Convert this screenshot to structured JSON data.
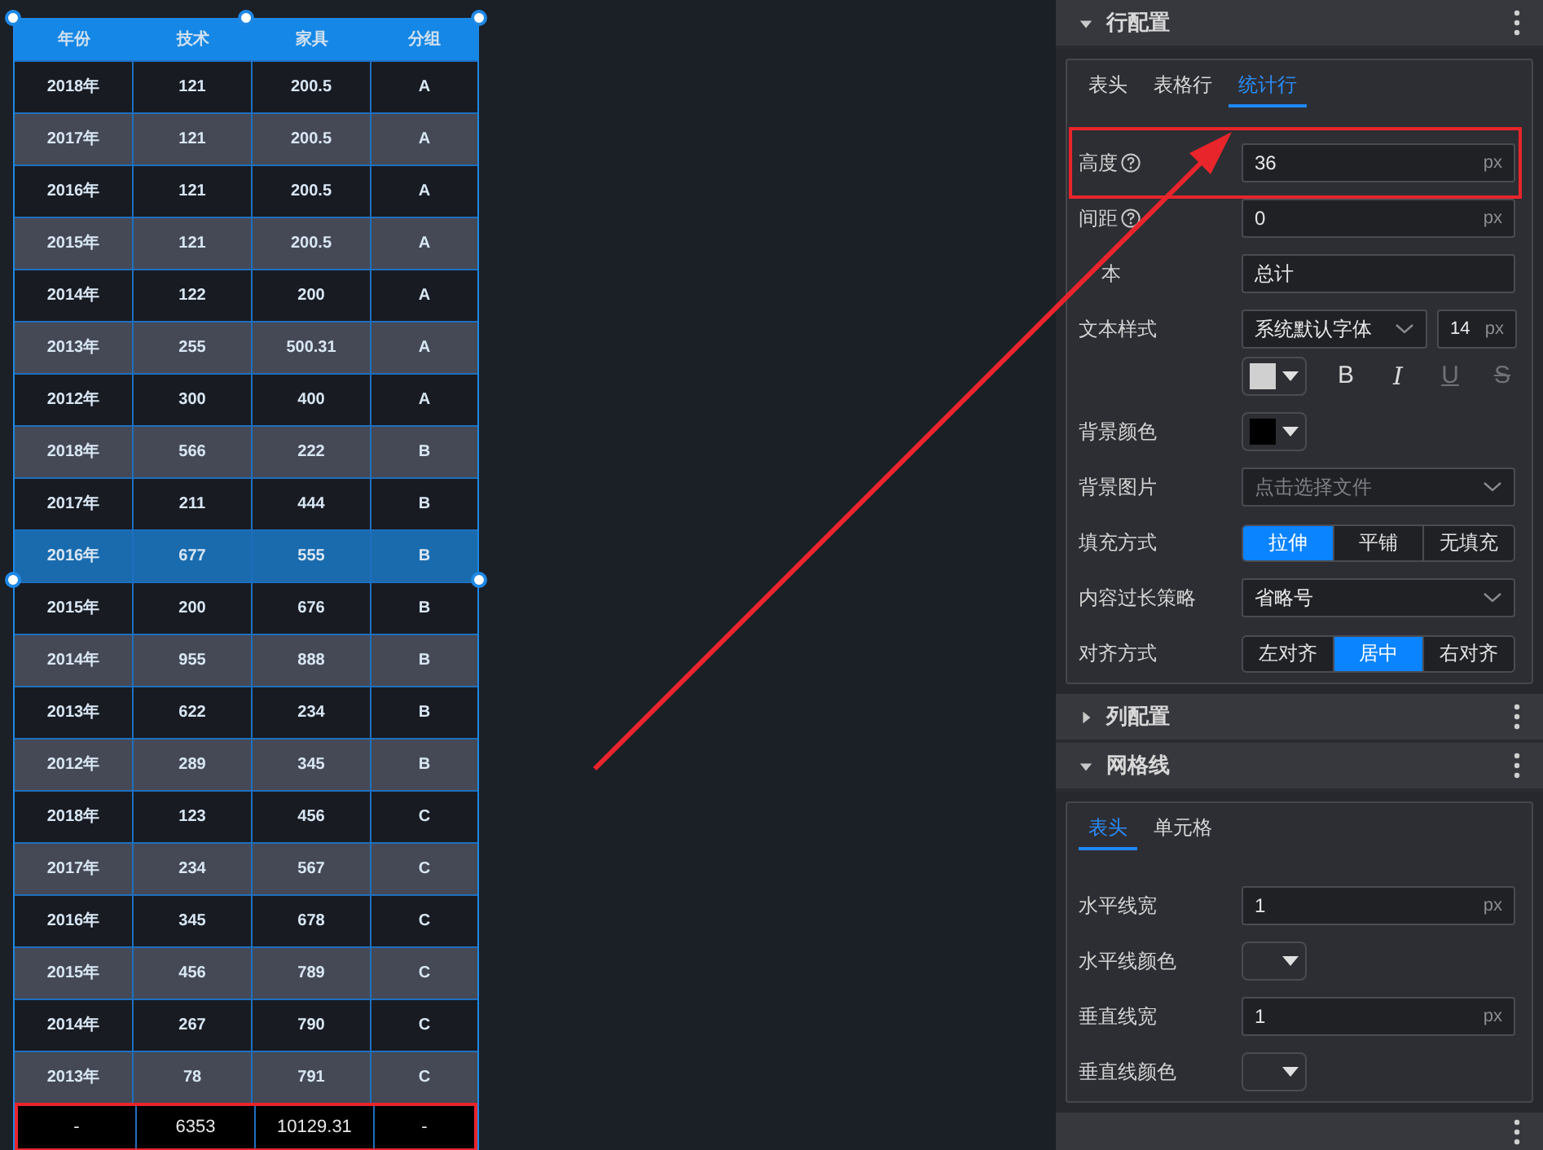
{
  "table": {
    "columns": [
      "年份",
      "技术",
      "家具",
      "分组"
    ],
    "rows": [
      {
        "cells": [
          "2018年",
          "121",
          "200.5",
          "A"
        ],
        "selected": false
      },
      {
        "cells": [
          "2017年",
          "121",
          "200.5",
          "A"
        ],
        "selected": false
      },
      {
        "cells": [
          "2016年",
          "121",
          "200.5",
          "A"
        ],
        "selected": false
      },
      {
        "cells": [
          "2015年",
          "121",
          "200.5",
          "A"
        ],
        "selected": false
      },
      {
        "cells": [
          "2014年",
          "122",
          "200",
          "A"
        ],
        "selected": false
      },
      {
        "cells": [
          "2013年",
          "255",
          "500.31",
          "A"
        ],
        "selected": false
      },
      {
        "cells": [
          "2012年",
          "300",
          "400",
          "A"
        ],
        "selected": false
      },
      {
        "cells": [
          "2018年",
          "566",
          "222",
          "B"
        ],
        "selected": false
      },
      {
        "cells": [
          "2017年",
          "211",
          "444",
          "B"
        ],
        "selected": false
      },
      {
        "cells": [
          "2016年",
          "677",
          "555",
          "B"
        ],
        "selected": true
      },
      {
        "cells": [
          "2015年",
          "200",
          "676",
          "B"
        ],
        "selected": false
      },
      {
        "cells": [
          "2014年",
          "955",
          "888",
          "B"
        ],
        "selected": false
      },
      {
        "cells": [
          "2013年",
          "622",
          "234",
          "B"
        ],
        "selected": false
      },
      {
        "cells": [
          "2012年",
          "289",
          "345",
          "B"
        ],
        "selected": false
      },
      {
        "cells": [
          "2018年",
          "123",
          "456",
          "C"
        ],
        "selected": false
      },
      {
        "cells": [
          "2017年",
          "234",
          "567",
          "C"
        ],
        "selected": false
      },
      {
        "cells": [
          "2016年",
          "345",
          "678",
          "C"
        ],
        "selected": false
      },
      {
        "cells": [
          "2015年",
          "456",
          "789",
          "C"
        ],
        "selected": false
      },
      {
        "cells": [
          "2014年",
          "267",
          "790",
          "C"
        ],
        "selected": false
      },
      {
        "cells": [
          "2013年",
          "78",
          "791",
          "C"
        ],
        "selected": false
      }
    ],
    "summary_row": {
      "cells": [
        "-",
        "6353",
        "10129.31",
        "-"
      ],
      "highlighted": true
    }
  },
  "panel": {
    "sections": [
      {
        "title": "行配置",
        "expanded": true,
        "tabs": [
          {
            "label": "表头",
            "selected": false
          },
          {
            "label": "表格行",
            "selected": false
          },
          {
            "label": "统计行",
            "selected": true
          }
        ],
        "fields": [
          {
            "kind": "number",
            "label": "高度",
            "help": true,
            "value": "36",
            "unit": "px",
            "highlighted": true
          },
          {
            "kind": "number",
            "label": "间距",
            "help": true,
            "value": "0",
            "unit": "px",
            "highlighted": false
          },
          {
            "kind": "text",
            "label": "本",
            "value": "总计"
          },
          {
            "kind": "font",
            "label": "文本样式",
            "font": "系统默认字体",
            "size": "14",
            "unit": "px",
            "color": "#d0d0d0",
            "styles": [
              {
                "label": "B",
                "disabled": false
              },
              {
                "label": "I",
                "disabled": false
              },
              {
                "label": "U",
                "disabled": true
              },
              {
                "label": "S",
                "disabled": true
              }
            ]
          },
          {
            "kind": "color",
            "label": "背景颜色",
            "color": "#000000"
          },
          {
            "kind": "select",
            "label": "背景图片",
            "placeholder": "点击选择文件"
          },
          {
            "kind": "segmented",
            "label": "填充方式",
            "options": [
              {
                "label": "拉伸",
                "selected": true
              },
              {
                "label": "平铺",
                "selected": false
              },
              {
                "label": "无填充",
                "selected": false
              }
            ]
          },
          {
            "kind": "select",
            "label": "内容过长策略",
            "value": "省略号"
          },
          {
            "kind": "segmented",
            "label": "对齐方式",
            "options": [
              {
                "label": "左对齐",
                "selected": false
              },
              {
                "label": "居中",
                "selected": true
              },
              {
                "label": "右对齐",
                "selected": false
              }
            ]
          }
        ]
      },
      {
        "title": "列配置",
        "expanded": false
      },
      {
        "title": "网格线",
        "expanded": true,
        "tabs": [
          {
            "label": "表头",
            "selected": true
          },
          {
            "label": "单元格",
            "selected": false
          }
        ],
        "fields": [
          {
            "kind": "number",
            "label": "水平线宽",
            "value": "1",
            "unit": "px",
            "help": false,
            "highlighted": false
          },
          {
            "kind": "color",
            "label": "水平线颜色"
          },
          {
            "kind": "number",
            "label": "垂直线宽",
            "value": "1",
            "unit": "px",
            "help": false,
            "highlighted": false
          },
          {
            "kind": "color",
            "label": "垂直线颜色"
          }
        ]
      }
    ]
  }
}
